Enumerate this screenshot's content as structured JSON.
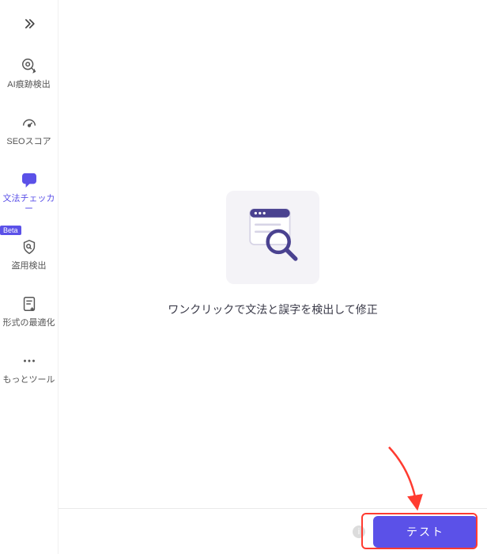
{
  "sidebar": {
    "items": [
      {
        "label": "AI痕跡検出"
      },
      {
        "label": "SEOスコア"
      },
      {
        "label": "文法チェッカー"
      },
      {
        "badge": "Beta",
        "label": "盗用検出"
      },
      {
        "label": "形式の最適化"
      },
      {
        "label": "もっとツール"
      }
    ]
  },
  "main": {
    "empty_caption": "ワンクリックで文法と誤字を検出して修正"
  },
  "footer": {
    "hint": "i",
    "primary_button": "テスト"
  }
}
